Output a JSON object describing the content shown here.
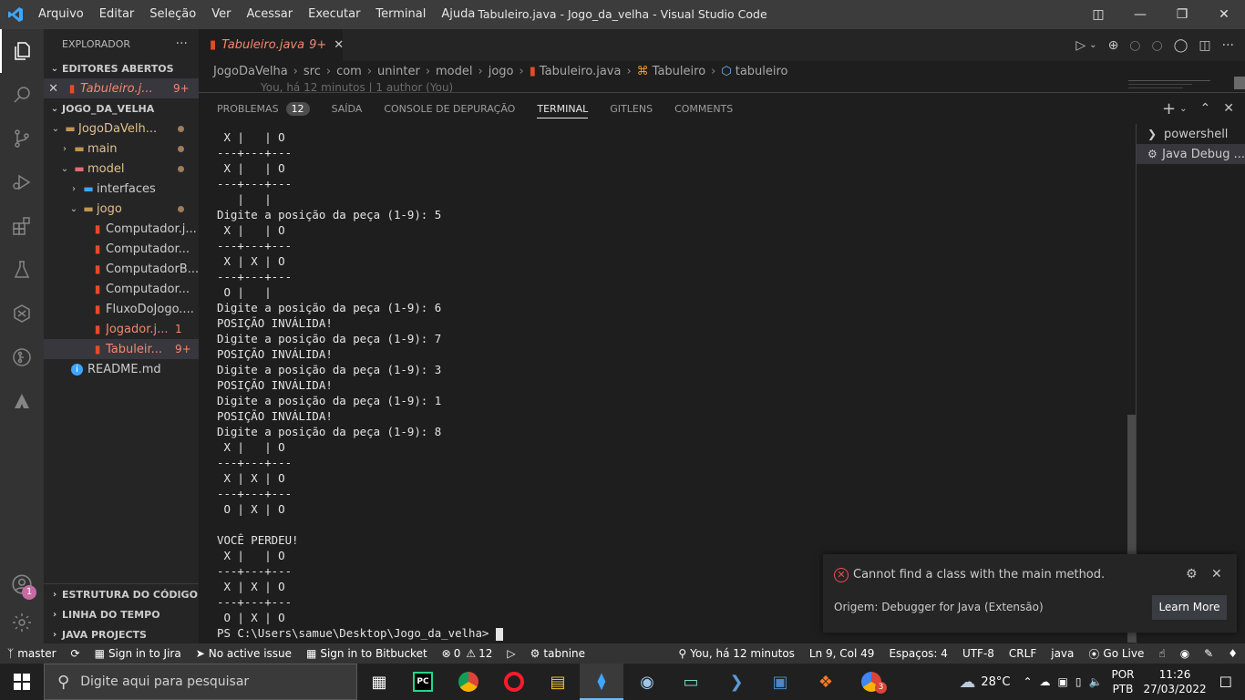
{
  "window": {
    "title": "Tabuleiro.java - Jogo_da_velha - Visual Studio Code",
    "menu": [
      "Arquivo",
      "Editar",
      "Seleção",
      "Ver",
      "Acessar",
      "Executar",
      "Terminal",
      "Ajuda"
    ]
  },
  "activity": {
    "account_badge": "1"
  },
  "sidebar": {
    "header": "EXPLORADOR",
    "open_editors": {
      "label": "EDITORES ABERTOS",
      "items": [
        {
          "name": "Tabuleiro.j...",
          "badge": "9+"
        }
      ]
    },
    "project": {
      "label": "JOGO_DA_VELHA",
      "tree": [
        {
          "label": "JogoDaVelh...",
          "kind": "folder",
          "depth": 1,
          "expanded": true,
          "dot": true
        },
        {
          "label": "main",
          "kind": "folder",
          "depth": 2,
          "expanded": false,
          "dot": true
        },
        {
          "label": "model",
          "kind": "folder",
          "depth": 2,
          "expanded": true,
          "dot": true
        },
        {
          "label": "interfaces",
          "kind": "folder",
          "depth": 3,
          "expanded": false,
          "dot": false
        },
        {
          "label": "jogo",
          "kind": "folder",
          "depth": 3,
          "expanded": true,
          "dot": true
        },
        {
          "label": "Computador.j...",
          "kind": "java",
          "depth": 4
        },
        {
          "label": "Computador...",
          "kind": "java",
          "depth": 4
        },
        {
          "label": "ComputadorB...",
          "kind": "java",
          "depth": 4
        },
        {
          "label": "Computador...",
          "kind": "java",
          "depth": 4
        },
        {
          "label": "FluxoDoJogo....",
          "kind": "java",
          "depth": 4
        },
        {
          "label": "Jogador.j...",
          "kind": "java",
          "depth": 4,
          "badge": "1",
          "status": "err"
        },
        {
          "label": "Tabuleir...",
          "kind": "java",
          "depth": 4,
          "badge": "9+",
          "status": "err",
          "selected": true
        },
        {
          "label": "README.md",
          "kind": "info",
          "depth": 2
        }
      ]
    },
    "bottom_sections": [
      "ESTRUTURA DO CÓDIGO",
      "LINHA DO TEMPO",
      "JAVA PROJECTS"
    ]
  },
  "editor": {
    "tab": {
      "name": "Tabuleiro.java",
      "badge": "9+"
    },
    "breadcrumb": [
      "JogoDaVelha",
      "src",
      "com",
      "uninter",
      "model",
      "jogo",
      "Tabuleiro.java",
      "Tabuleiro",
      "tabuleiro"
    ],
    "blame": "You, há 12 minutos | 1 author (You)"
  },
  "panel": {
    "tabs": [
      {
        "label": "PROBLEMAS",
        "badge": "12"
      },
      {
        "label": "SAÍDA"
      },
      {
        "label": "CONSOLE DE DEPURAÇÃO"
      },
      {
        "label": "TERMINAL",
        "active": true
      },
      {
        "label": "GITLENS"
      },
      {
        "label": "COMMENTS"
      }
    ],
    "terminal_lines": [
      " X |   | O",
      "---+---+---",
      " X |   | O",
      "---+---+---",
      "   |   |",
      "Digite a posição da peça (1-9): 5",
      " X |   | O",
      "---+---+---",
      " X | X | O",
      "---+---+---",
      " O |   |",
      "Digite a posição da peça (1-9): 6",
      "POSIÇÃO INVÁLIDA!",
      "Digite a posição da peça (1-9): 7",
      "POSIÇÃO INVÁLIDA!",
      "Digite a posição da peça (1-9): 3",
      "POSIÇÃO INVÁLIDA!",
      "Digite a posição da peça (1-9): 1",
      "POSIÇÃO INVÁLIDA!",
      "Digite a posição da peça (1-9): 8",
      " X |   | O",
      "---+---+---",
      " X | X | O",
      "---+---+---",
      " O | X | O",
      "",
      "VOCÊ PERDEU!",
      " X |   | O",
      "---+---+---",
      " X | X | O",
      "---+---+---",
      " O | X | O",
      "PS C:\\Users\\samue\\Desktop\\Jogo_da_velha> "
    ],
    "terminals": [
      {
        "label": "powershell"
      },
      {
        "label": "Java Debug ...",
        "selected": true
      }
    ]
  },
  "notification": {
    "message": "Cannot find a class with the main method.",
    "source": "Origem: Debugger for Java (Extensão)",
    "button": "Learn More"
  },
  "statusbar": {
    "left": [
      "master",
      "Sign in to Jira",
      "No active issue",
      "Sign in to Bitbucket",
      "0",
      "12",
      "tabnine"
    ],
    "right": [
      "You, há 12 minutos",
      "Ln 9, Col 49",
      "Espaços: 4",
      "UTF-8",
      "CRLF",
      "java",
      "Go Live"
    ]
  },
  "taskbar": {
    "search_placeholder": "Digite aqui para pesquisar",
    "temperature": "28°C",
    "lang": "POR",
    "layout": "PTB",
    "time": "11:26",
    "date": "27/03/2022",
    "chrome_badge": "3"
  },
  "colors": {
    "accent": "#007acc",
    "modified": "#e2c08d",
    "error": "#f48771"
  }
}
